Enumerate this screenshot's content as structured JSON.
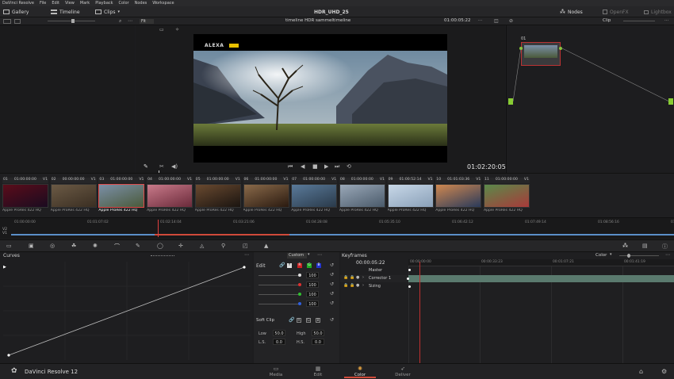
{
  "menu": [
    "DaVinci Resolve",
    "File",
    "Edit",
    "View",
    "Mark",
    "Playback",
    "Color",
    "Nodes",
    "Workspace"
  ],
  "topbar": {
    "gallery": "Gallery",
    "timeline": "Timeline",
    "clips": "Clips",
    "project_title": "HDR_UHD_25",
    "nodes": "Nodes",
    "openfx": "OpenFX",
    "lightbox": "Lightbox"
  },
  "viewer": {
    "zoom": "Fit",
    "timeline_name": "timeline HDR sammeltimeline",
    "timecode_top": "01:00:05:22",
    "clip_mode": "Clip",
    "timecode": "01:02:20:05",
    "camera_logo": "ALEXA"
  },
  "node": {
    "label": "01"
  },
  "clips": [
    {
      "num": "01",
      "tc": "01:00:00:00",
      "track": "V1",
      "codec": "Apple ProRes 422 HQ",
      "c1": "#5b0d1a",
      "c2": "#1a0b20"
    },
    {
      "num": "02",
      "tc": "00:00:00:00",
      "track": "V1",
      "codec": "Apple ProRes 422 HQ",
      "c1": "#6b5a45",
      "c2": "#3a2e22"
    },
    {
      "num": "03",
      "tc": "01:00:00:00",
      "track": "V1",
      "codec": "Apple ProRes 422 HQ",
      "c1": "#7b8fa8",
      "c2": "#4a5a3a",
      "selected": true
    },
    {
      "num": "04",
      "tc": "01:00:00:00",
      "track": "V1",
      "codec": "Apple ProRes 422 HQ",
      "c1": "#c97a8a",
      "c2": "#6a2a3a"
    },
    {
      "num": "05",
      "tc": "01:00:00:00",
      "track": "V1",
      "codec": "Apple ProRes 422 HQ",
      "c1": "#6a4a30",
      "c2": "#1a1410"
    },
    {
      "num": "06",
      "tc": "01:00:00:00",
      "track": "V1",
      "codec": "Apple ProRes 422 HQ",
      "c1": "#8a6a4a",
      "c2": "#2a1a10"
    },
    {
      "num": "07",
      "tc": "01:00:00:00",
      "track": "V1",
      "codec": "Apple ProRes 422 HQ",
      "c1": "#5a7a9a",
      "c2": "#2a3a4a"
    },
    {
      "num": "08",
      "tc": "01:00:00:00",
      "track": "V1",
      "codec": "Apple ProRes 422 HQ",
      "c1": "#9aa8b8",
      "c2": "#4a5a6a"
    },
    {
      "num": "09",
      "tc": "01:00:52:14",
      "track": "V1",
      "codec": "Apple ProRes 422 HQ",
      "c1": "#c8d8e8",
      "c2": "#8aa0b8"
    },
    {
      "num": "10",
      "tc": "01:01:03:36",
      "track": "V1",
      "codec": "Apple ProRes 422 HQ",
      "c1": "#d08850",
      "c2": "#2a3a5a"
    },
    {
      "num": "11",
      "tc": "01:00:00:00",
      "track": "V1",
      "codec": "Apple ProRes 422 HQ",
      "c1": "#5a8a4a",
      "c2": "#a83a3a"
    }
  ],
  "timeline_ticks": [
    "01:00:00:00",
    "01:01:07:02",
    "01:02:14:04",
    "01:03:21:06",
    "01:04:28:08",
    "01:05:35:10",
    "01:06:42:12",
    "01:07:49:14",
    "01:08:56:16",
    "01:10:03:18"
  ],
  "tracks": [
    "V2",
    "V1"
  ],
  "curves": {
    "title": "Curves"
  },
  "edit": {
    "title": "Edit",
    "mode": "Custom",
    "channels": [
      {
        "color": "#e0e0e0",
        "value": "100"
      },
      {
        "color": "#e03030",
        "value": "100"
      },
      {
        "color": "#30c030",
        "value": "100"
      },
      {
        "color": "#3060e0",
        "value": "100"
      }
    ],
    "soft_clip": "Soft Clip",
    "low_label": "Low",
    "low": "50.0",
    "high_label": "High",
    "high": "50.0",
    "ls_label": "L.S.",
    "ls": "0.0",
    "hs_label": "H.S.",
    "hs": "0.0"
  },
  "keyframes": {
    "title": "Keyframes",
    "mode": "Color",
    "timecode": "00:00:05:22",
    "ruler": [
      "00:00:00:00",
      "00:00:33:23",
      "00:01:07:21",
      "00:01:41:19"
    ],
    "rows": [
      "Master",
      "Corrector 1",
      "Sizing"
    ]
  },
  "bottom": {
    "app": "DaVinci Resolve 12",
    "pages": [
      "Media",
      "Edit",
      "Color",
      "Deliver"
    ]
  }
}
